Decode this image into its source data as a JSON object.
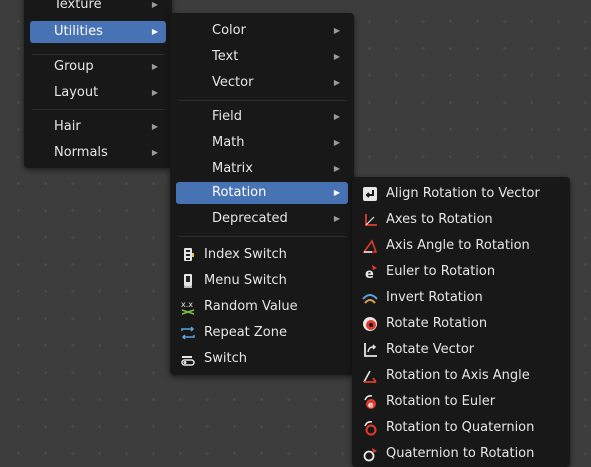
{
  "menu_l1": {
    "items": [
      {
        "label": "Texture",
        "submenu": true
      },
      {
        "label": "Utilities",
        "submenu": true,
        "active": true
      },
      {
        "label": "Group",
        "submenu": true
      },
      {
        "label": "Layout",
        "submenu": true
      },
      {
        "label": "Hair",
        "submenu": true
      },
      {
        "label": "Normals",
        "submenu": true
      }
    ]
  },
  "menu_l2": {
    "items": [
      {
        "label": "Color",
        "submenu": true
      },
      {
        "label": "Text",
        "submenu": true
      },
      {
        "label": "Vector",
        "submenu": true
      },
      {
        "label": "Field",
        "submenu": true
      },
      {
        "label": "Math",
        "submenu": true
      },
      {
        "label": "Matrix",
        "submenu": true
      },
      {
        "label": "Rotation",
        "submenu": true,
        "active": true
      },
      {
        "label": "Deprecated",
        "submenu": true
      },
      {
        "label": "Index Switch",
        "icon": "index-switch-icon"
      },
      {
        "label": "Menu Switch",
        "icon": "menu-switch-icon"
      },
      {
        "label": "Random Value",
        "icon": "random-value-icon"
      },
      {
        "label": "Repeat Zone",
        "icon": "repeat-zone-icon"
      },
      {
        "label": "Switch",
        "icon": "switch-icon"
      }
    ]
  },
  "menu_l3": {
    "items": [
      {
        "label": "Align Rotation to Vector",
        "icon": "align-rotation-to-vector-icon"
      },
      {
        "label": "Axes to Rotation",
        "icon": "axes-to-rotation-icon"
      },
      {
        "label": "Axis Angle to Rotation",
        "icon": "axis-angle-to-rotation-icon"
      },
      {
        "label": "Euler to Rotation",
        "icon": "euler-to-rotation-icon"
      },
      {
        "label": "Invert Rotation",
        "icon": "invert-rotation-icon"
      },
      {
        "label": "Rotate Rotation",
        "icon": "rotate-rotation-icon"
      },
      {
        "label": "Rotate Vector",
        "icon": "rotate-vector-icon"
      },
      {
        "label": "Rotation to Axis Angle",
        "icon": "rotation-to-axis-angle-icon"
      },
      {
        "label": "Rotation to Euler",
        "icon": "rotation-to-euler-icon"
      },
      {
        "label": "Rotation to Quaternion",
        "icon": "rotation-to-quaternion-icon"
      },
      {
        "label": "Quaternion to Rotation",
        "icon": "quaternion-to-rotation-icon"
      }
    ]
  },
  "colors": {
    "background": "#3d3d3d",
    "menu": "#181818",
    "highlight": "#4772b3",
    "text": "#e6e6e6",
    "icon_red": "#e23b2e"
  }
}
